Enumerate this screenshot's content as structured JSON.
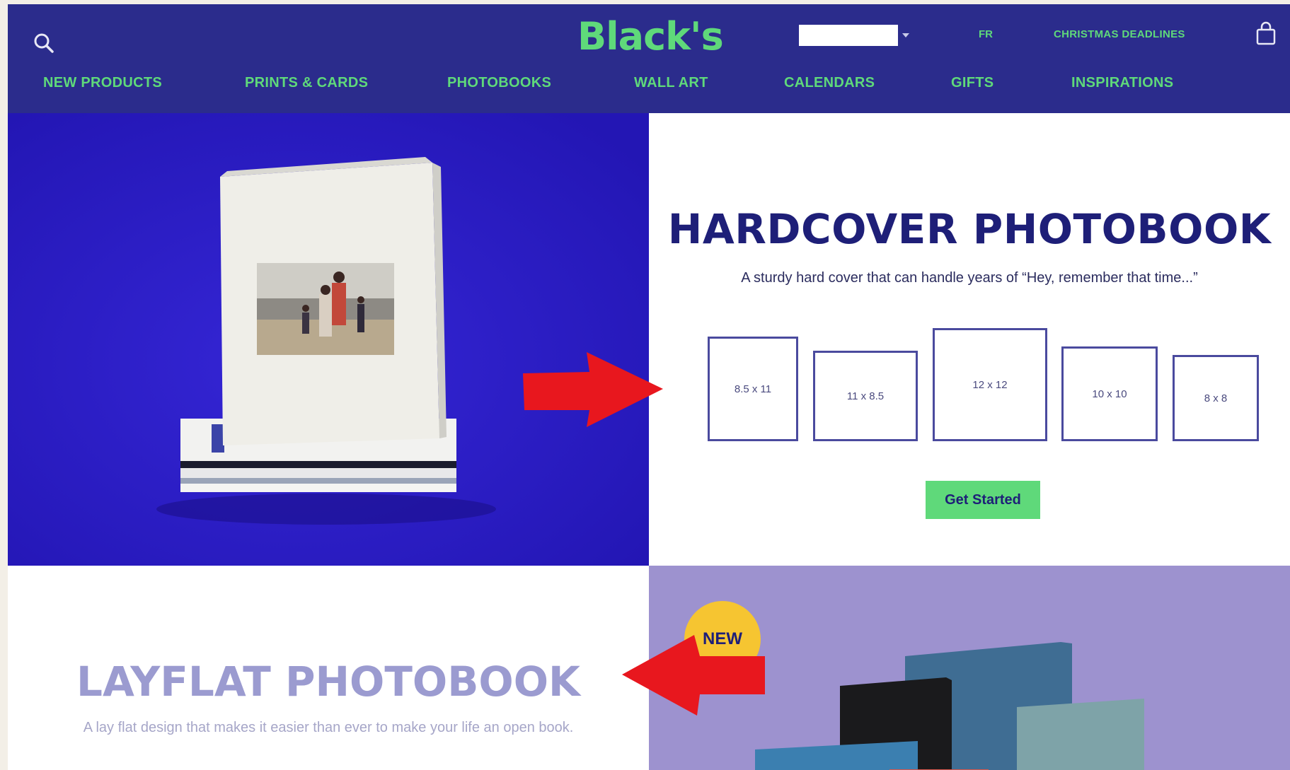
{
  "header": {
    "logo": "Black's",
    "account_name": "██████████",
    "language": "FR",
    "deadlines": "CHRISTMAS DEADLINES"
  },
  "nav": {
    "items": [
      {
        "label": "NEW PRODUCTS"
      },
      {
        "label": "PRINTS & CARDS"
      },
      {
        "label": "PHOTOBOOKS"
      },
      {
        "label": "WALL ART"
      },
      {
        "label": "CALENDARS"
      },
      {
        "label": "GIFTS"
      },
      {
        "label": "INSPIRATIONS"
      }
    ]
  },
  "hero": {
    "title": "HARDCOVER PHOTOBOOK",
    "subtitle": "A sturdy hard cover that can handle years of “Hey, remember that time...”",
    "sizes": [
      "8.5 x 11",
      "11 x 8.5",
      "12 x 12",
      "10 x 10",
      "8 x 8"
    ],
    "cta": "Get Started"
  },
  "layflat": {
    "title": "LAYFLAT PHOTOBOOK",
    "subtitle": "A lay flat design that makes it easier than ever to make your life an open book.",
    "badge": "NEW"
  },
  "icons": {
    "search": "search-icon",
    "cart": "shopping-bag-icon",
    "arrow": "red-arrow-icon"
  },
  "colors": {
    "header_bg": "#2b2c8c",
    "accent_green": "#5fd97a",
    "hero_bg": "#2b1fc4",
    "title_navy": "#1e1f78",
    "lavender": "#9d92cf",
    "badge_yellow": "#f6c531",
    "arrow_red": "#e8171e"
  }
}
